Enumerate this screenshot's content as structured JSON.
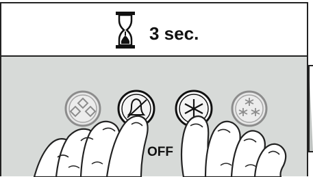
{
  "instruction": {
    "duration_label": "3 sec."
  },
  "panel": {
    "buttons": [
      {
        "name": "diamond-pattern-button",
        "icon": "diamond-pattern-icon",
        "state": "inactive"
      },
      {
        "name": "alarm-off-button",
        "icon": "bell-off-icon",
        "state": "pressed"
      },
      {
        "name": "freeze-button",
        "icon": "asterisk-icon",
        "state": "pressed"
      },
      {
        "name": "super-freeze-button",
        "icon": "snowflakes-icon",
        "state": "inactive"
      }
    ],
    "off_label": "OFF"
  },
  "colors": {
    "panel_background": "#d7dad8",
    "header_background": "#ffffff",
    "button_active_ring": "#222222",
    "button_inactive_ring": "#8c8c8c",
    "finger_fill": "#ffffff",
    "finger_stroke": "#222222"
  }
}
